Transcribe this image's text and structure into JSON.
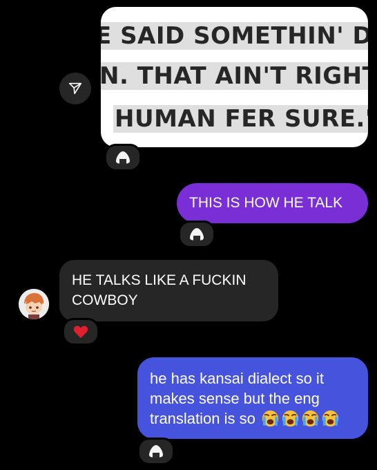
{
  "shared_image": {
    "lines": [
      "E SAID SOMETHIN' DO",
      "N. THAT AIN'T RIGHT-",
      "HUMAN FER SURE.\""
    ]
  },
  "messages": {
    "sent_1": "THIS IS HOW HE TALK",
    "received_1": "HE TALKS LIKE A FUCKIN COWBOY",
    "sent_2": "he has kansai dialect so it makes sense but the eng translation is so"
  },
  "reactions": {
    "image": "onigiri-icon",
    "sent_1": "onigiri-icon",
    "received_1": "red-heart-icon",
    "sent_2": "onigiri-icon"
  },
  "trailing_emoji": [
    "loudly-crying-face",
    "loudly-crying-face",
    "loudly-crying-face",
    "loudly-crying-face"
  ],
  "colors": {
    "background": "#000000",
    "purple_bubble": "#7a2fd6",
    "blue_bubble": "#4653dd",
    "gray_bubble": "#262626",
    "heart": "#e0202f"
  }
}
